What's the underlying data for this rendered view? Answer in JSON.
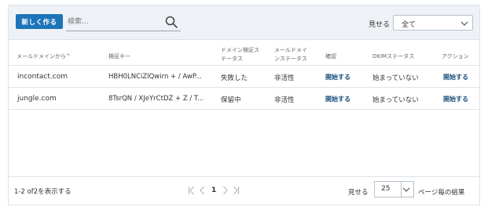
{
  "toolbar": {
    "new_button": "新しく作る",
    "search_placeholder": "検索...",
    "show_label": "見せる",
    "filter_value": "全て"
  },
  "table": {
    "headers": [
      "メールドメインから^",
      "検証キー",
      "ドメイン検証ス\nテータス",
      "メールドメイ\nンステータス",
      "確認",
      "DKIMステータス",
      "アクション"
    ],
    "rows": [
      {
        "domain": "incontact.com",
        "key": "HBH0LNCiZlQwirn + / AwP...",
        "verify_status": "失敗した",
        "mail_status": "非活性",
        "confirm": "開始する",
        "dkim": "始まっていない",
        "action": "開始する"
      },
      {
        "domain": "jungle.com",
        "key": "8TsrQN / XJeYrCtDZ + Z / T...",
        "verify_status": "保留中",
        "mail_status": "非活性",
        "confirm": "開始する",
        "dkim": "始まっていない",
        "action": "開始する"
      }
    ]
  },
  "footer": {
    "range_text": "1-2 of2を表示する",
    "current_page": "1",
    "show_label": "見せる",
    "page_size": "25",
    "per_page_label": "ページ毎の結果"
  },
  "colors": {
    "accent": "#1d74b8",
    "link": "#1a4f7a",
    "toolbar_bg": "#eef2f7"
  },
  "icons": [
    "search-icon",
    "chevron-down-icon",
    "first-page-icon",
    "prev-page-icon",
    "next-page-icon",
    "last-page-icon"
  ]
}
